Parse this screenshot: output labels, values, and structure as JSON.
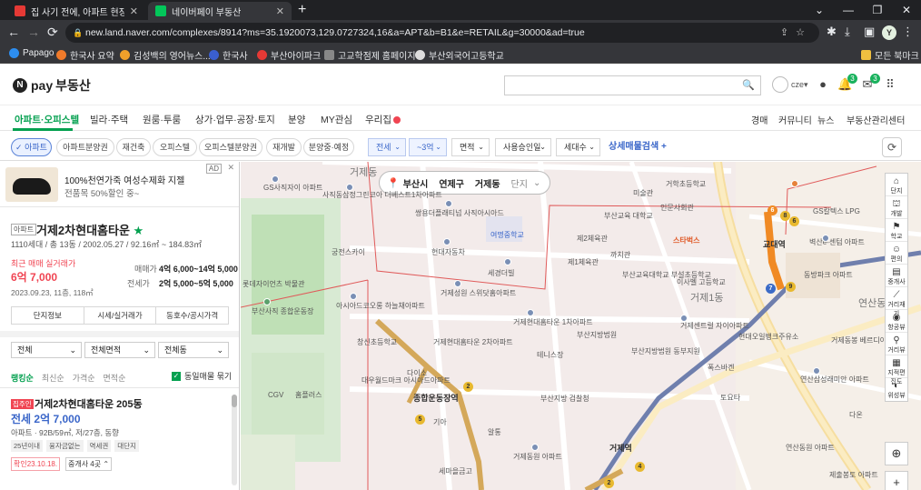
{
  "browser": {
    "tabs": [
      {
        "title": "집 사기 전에, 아파트 현장 방문"
      },
      {
        "title": "네이버페이 부동산"
      }
    ],
    "url": "new.land.naver.com/complexes/8914?ms=35.1920073,129.0727324,16&a=APT&b=B1&e=RETAIL&g=30000&ad=true",
    "profile_initial": "Y",
    "bookmarks": [
      "Papago",
      "한국사 요약",
      "김성백의 영어뉴스...",
      "한국사",
      "부산아이파크",
      "고교학점제 홈페이지",
      "부산외국어고등학교"
    ],
    "all_bookmarks": "모든 북마크"
  },
  "header": {
    "logo_pay": "pay",
    "logo_text": "부동산",
    "user": "cze",
    "notif_count": "3",
    "mail_count": "3"
  },
  "gnav": {
    "items": [
      "아파트·오피스텔",
      "빌라·주택",
      "원룸·투룸",
      "상가·업무·공장·토지",
      "분양",
      "MY관심",
      "우리집"
    ],
    "right": [
      "경매",
      "커뮤니티",
      "뉴스",
      "부동산관리센터"
    ]
  },
  "filters": {
    "chips": [
      "아파트",
      "아파트분양권",
      "재건축",
      "오피스텔",
      "오피스텔분양권",
      "재개발",
      "분양중·예정"
    ],
    "dropdowns": [
      "전세",
      "~3억",
      "면적",
      "사용승인일",
      "세대수"
    ],
    "detail": "상세매물검색",
    "plus": "+"
  },
  "ad": {
    "label": "AD",
    "line1": "100%천연가죽 여성수제화 지젤",
    "line2": "전품목 50%할인 중~"
  },
  "complex": {
    "tag": "아파트",
    "name": "거제2차현대홈타운",
    "info": "1110세대 / 총 13동 / 2002.05.27 / 92.16㎡ ~ 184.83㎡",
    "recent_label": "최근 매매 실거래가",
    "recent_price": "6억 7,000",
    "recent_date": "2023.09.23, 11층, 118㎡",
    "sale_label": "매매가",
    "sale_value": "4억 6,000~14억 5,000",
    "rent_label": "전세가",
    "rent_value": "2억 5,000~5억 5,000",
    "tabs": [
      "단지정보",
      "시세/실거래가",
      "동호수/공시가격"
    ]
  },
  "list_filters": [
    "전체",
    "전체면적",
    "전체동"
  ],
  "sorts": [
    "랭킹순",
    "최신순",
    "가격순",
    "면적순"
  ],
  "same_listing": "동일매물 묶기",
  "listing": {
    "badge": "집주인",
    "name": "거제2차현대홈타운 205동",
    "price": "전세 2억 7,000",
    "info": "아파트 · 92B/59㎡, 저/27층, 동향",
    "tags": [
      "25년이내",
      "융자금없는",
      "역세권",
      "대단지"
    ],
    "confirm": "확인23.10.18.",
    "agents": "중개사 4곳"
  },
  "map": {
    "region": [
      "부산시",
      "연제구",
      "거제동",
      "단지"
    ],
    "tools": [
      "단지",
      "개발",
      "학교",
      "편의",
      "중개사",
      "거리재기",
      "항공뷰",
      "거리뷰",
      "지적편집도",
      "위성뷰"
    ],
    "labels": [
      "GS사직자이 아파트",
      "사직동삼정그린코아 더베스트1차아파트",
      "쌍용더플래티넘 사직아시아드",
      "여명중학교",
      "거학초등학교",
      "미술관",
      "궁전스카이",
      "현대자동차",
      "부산교육 대학교",
      "인문사회관",
      "교대역",
      "제2체육관",
      "제1체육관",
      "까치관",
      "부산교육대학교 부설초등학교",
      "세경더빌",
      "거제성원 스위닷홈아파트",
      "거제현대홈타운 1차아파트",
      "이사벨 고등학교",
      "거제1동",
      "롯데자이언츠 박물관",
      "부산사직 종합운동장",
      "아시아드코오롱 하늘채아파트",
      "거제현대홈타운 2차아파트",
      "부산지방법원",
      "거제센트럴 자이아파트",
      "현대오일뱅크주유소",
      "창신초등학교",
      "테니스장",
      "다이소",
      "대우월드마크 아시아드아파트",
      "종합운동장역",
      "부산지방 검찰청",
      "부산지방법원 동부지원",
      "폭스바겐",
      "토요타",
      "홈플러스",
      "CGV",
      "거제역",
      "기아",
      "알통",
      "세마을금고",
      "거제동원 아파트",
      "연산삼성래미안 아파트",
      "다온",
      "제출봉토 아파트",
      "벽산e-센텀 아파트",
      "거제동봉 베르디아아파트",
      "동방파크 아파트",
      "연산동원 아파트",
      "스타벅스",
      "GS칼텍스 LPG",
      "거제동",
      "연산동"
    ]
  }
}
